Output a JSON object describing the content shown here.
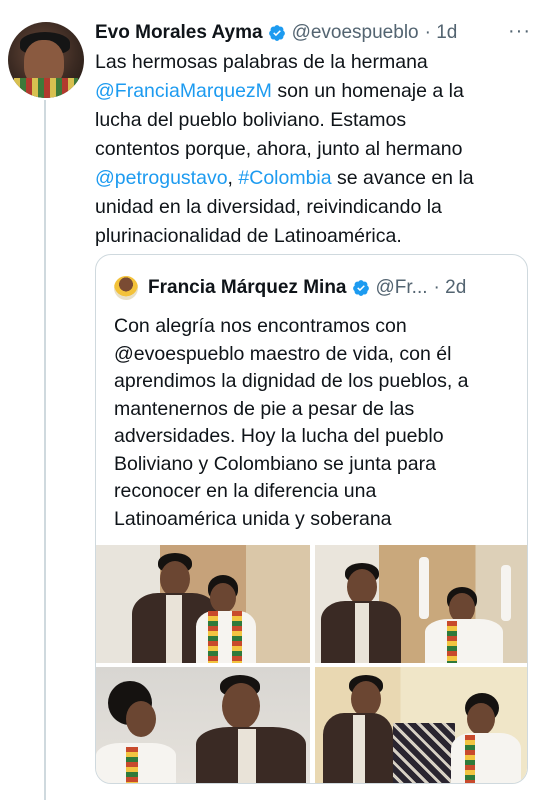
{
  "tweet": {
    "author_name": "Evo Morales Ayma",
    "author_handle": "@evoespueblo",
    "time": "· 1d",
    "more_label": "···",
    "lines": [
      [
        {
          "t": "Las hermosas palabras de la hermana",
          "link": false
        }
      ],
      [
        {
          "t": "@FranciaMarquezM",
          "link": true
        },
        {
          "t": " son un homenaje a la",
          "link": false
        }
      ],
      [
        {
          "t": "lucha del pueblo boliviano. Estamos",
          "link": false
        }
      ],
      [
        {
          "t": "contentos porque, ahora, junto al hermano",
          "link": false
        }
      ],
      [
        {
          "t": "@petrogustavo",
          "link": true
        },
        {
          "t": ", ",
          "link": false
        },
        {
          "t": "#Colombia",
          "link": true
        },
        {
          "t": " se avance en la",
          "link": false
        }
      ],
      [
        {
          "t": "unidad en la diversidad, reivindicando la",
          "link": false
        }
      ],
      [
        {
          "t": "plurinacionalidad de Latinoamérica.",
          "link": false
        }
      ]
    ]
  },
  "quote": {
    "author_name": "Francia Márquez Mina",
    "author_handle": "@Fr...",
    "time": "· 2d",
    "lines": [
      "Con alegría nos encontramos con",
      "@evoespueblo maestro de vida, con él",
      "aprendimos la dignidad de los pueblos, a",
      "mantenernos de pie a pesar de las",
      "adversidades. Hoy la lucha del pueblo",
      "Boliviano y Colombiano se junta para",
      "reconocer en la diferencia una",
      "Latinoamérica unida y soberana"
    ]
  },
  "colors": {
    "link": "#1d9bf0",
    "verified": "#1d9bf0",
    "text": "#0f1419",
    "secondary": "#536471",
    "border": "#cfd9de"
  },
  "icons": {
    "verified": "verified-badge-icon",
    "more": "more-horizontal-icon"
  }
}
